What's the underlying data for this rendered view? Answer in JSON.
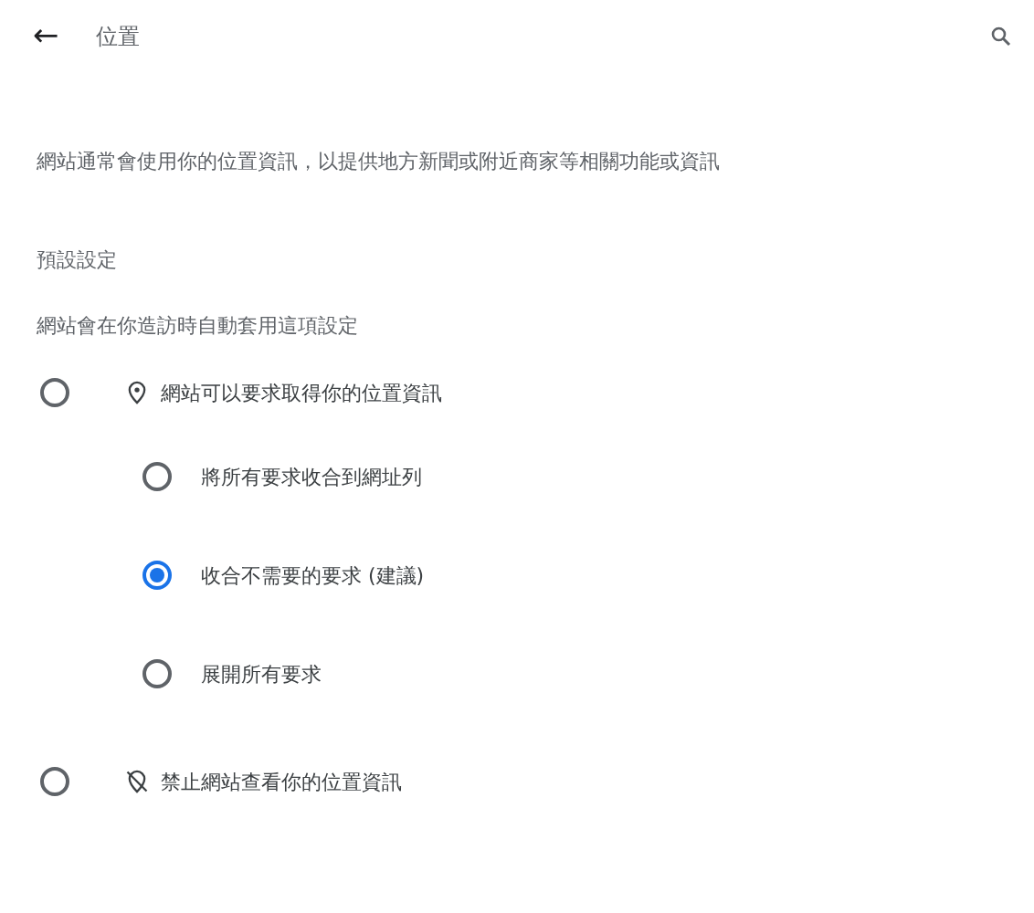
{
  "header": {
    "back": "←",
    "title": "位置"
  },
  "description": "網站通常會使用你的位置資訊，以提供地方新聞或附近商家等相關功能或資訊",
  "section": {
    "title": "預設設定",
    "subtitle": "網站會在你造訪時自動套用這項設定"
  },
  "options": [
    {
      "label": "網站可以要求取得你的位置資訊",
      "kind": "allow",
      "selected": false,
      "children": [
        {
          "label": "將所有要求收合到網址列",
          "selected": false
        },
        {
          "label": "收合不需要的要求 (建議)",
          "selected": true
        },
        {
          "label": "展開所有要求",
          "selected": false
        }
      ]
    },
    {
      "label": "禁止網站查看你的位置資訊",
      "kind": "block",
      "selected": false
    }
  ]
}
